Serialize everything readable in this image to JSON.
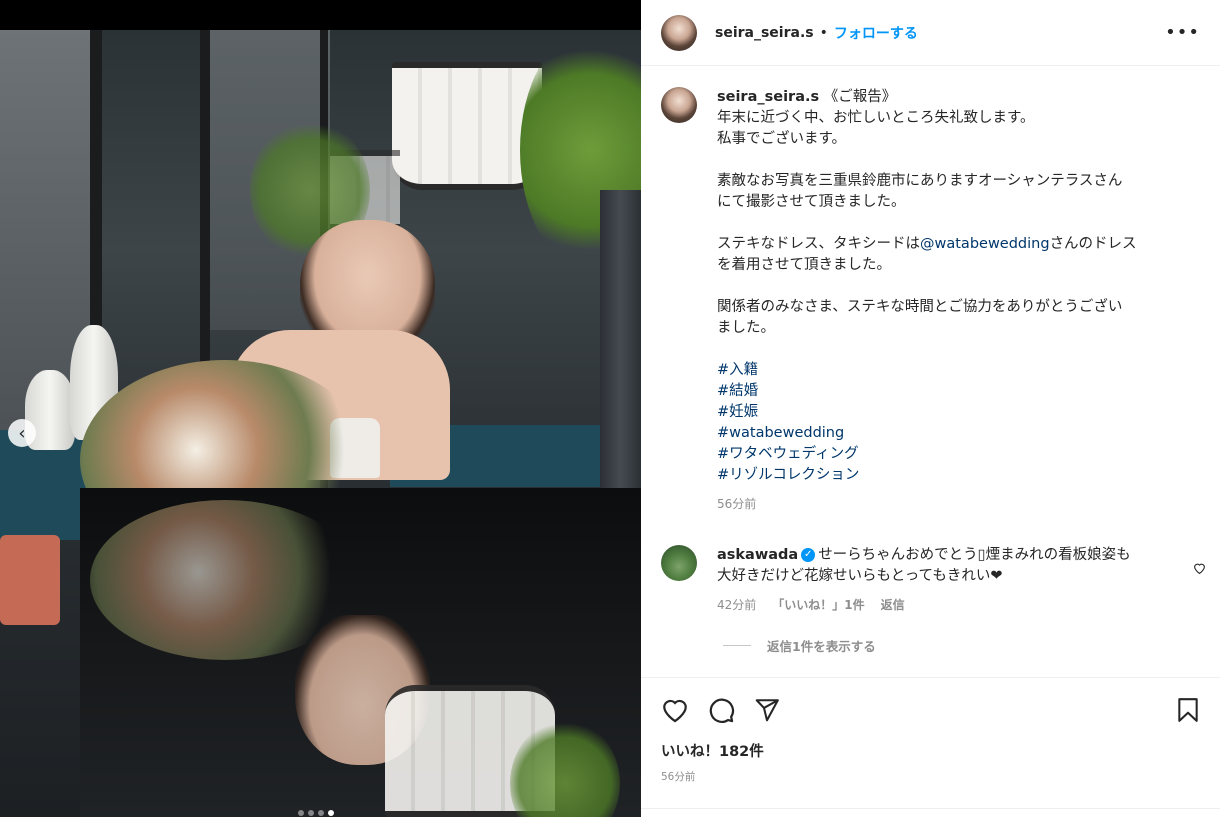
{
  "header": {
    "username": "seira_seira.s",
    "separator": "•",
    "follow_label": "フォローする",
    "more_icon": "more-horizontal-icon",
    "more_label": "•••"
  },
  "caption": {
    "username": "seira_seira.s",
    "title": "《ご報告》",
    "lines": [
      "年末に近づく中、お忙しいところ失礼致します。",
      "私事でございます。",
      "素敵なお写真を三重県鈴鹿市にありますオーシャンテラスさん",
      "にて撮影させて頂きました。",
      "ステキなドレス、タキシードは",
      "@watabewedding",
      "さんのドレス",
      "を着用させて頂きました。",
      "関係者のみなさま、ステキな時間とご協力をありがとうござい",
      "ました。"
    ],
    "hashtags": [
      "#入籍",
      "#結婚",
      "#妊娠",
      "#watabewedding",
      "#ワタベウェディング",
      "#リゾルコレクション"
    ],
    "time": "56分前"
  },
  "comment": {
    "username": "askawada",
    "verified": "✓",
    "text_line1": "せーらちゃんおめでとう▯煙まみれの看板娘姿も",
    "text_line2": "大好きだけど花嫁せいらもとってもきれい❤",
    "time": "42分前",
    "likes": "「いいね！」1件",
    "reply_label": "返信",
    "view_replies": "返信1件を表示する"
  },
  "actions": {
    "likes_count": "いいね！182件",
    "post_time": "56分前"
  },
  "carousel": {
    "prev_label": "‹",
    "slide_count": 4,
    "active_index": 3
  },
  "colors": {
    "link_blue": "#0095f6",
    "hashtag": "#00376b",
    "muted": "#8e8e8e",
    "text": "#262626"
  }
}
